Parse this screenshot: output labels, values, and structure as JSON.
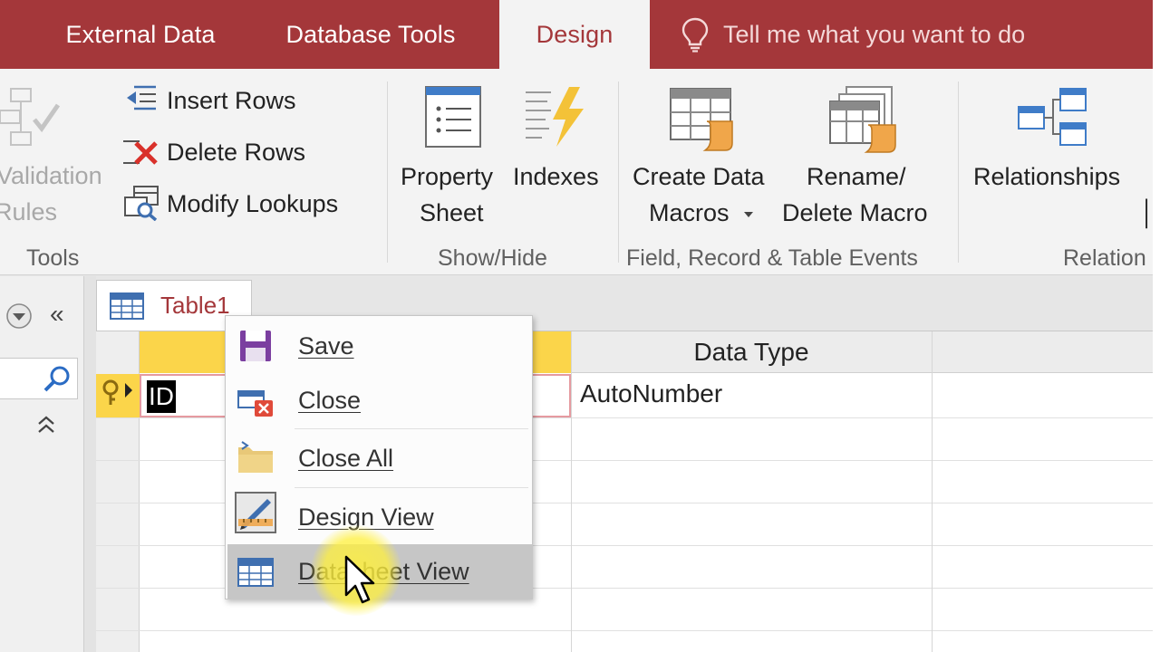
{
  "tabs": [
    {
      "label": "External Data"
    },
    {
      "label": "Database Tools"
    },
    {
      "label": "Design"
    }
  ],
  "tell_me": "Tell me what you want to do",
  "ribbon": {
    "tools": {
      "validation_line1": "Validation",
      "validation_line2": "Rules",
      "insert_rows": "Insert Rows",
      "delete_rows": "Delete Rows",
      "modify_lookups": "Modify Lookups",
      "group": "Tools"
    },
    "showhide": {
      "property_line1": "Property",
      "property_line2": "Sheet",
      "indexes": "Indexes",
      "group": "Show/Hide"
    },
    "events": {
      "create_line1": "Create Data",
      "create_line2": "Macros",
      "rename_line1": "Rename/",
      "rename_line2": "Delete Macro",
      "group": "Field, Record & Table Events"
    },
    "relationships": {
      "label": "Relationships",
      "group": "Relation"
    }
  },
  "document": {
    "tab_label": "Table1",
    "columns": {
      "data_type": "Data Type"
    },
    "rows": [
      {
        "field_name": "ID",
        "data_type": "AutoNumber"
      }
    ]
  },
  "context_menu": {
    "items": [
      {
        "label": "Save",
        "icon": "save-icon"
      },
      {
        "label": "Close",
        "icon": "close-object-icon"
      },
      {
        "label": "Close All",
        "icon": "folder-icon"
      },
      {
        "label": "Design View",
        "icon": "design-view-icon"
      },
      {
        "label": "Datasheet View",
        "icon": "datasheet-view-icon"
      }
    ],
    "highlighted": "Datasheet View"
  },
  "colors": {
    "accent": "#a4373a",
    "selection": "#fbd54a",
    "menu_hover": "#c6c6c6"
  }
}
